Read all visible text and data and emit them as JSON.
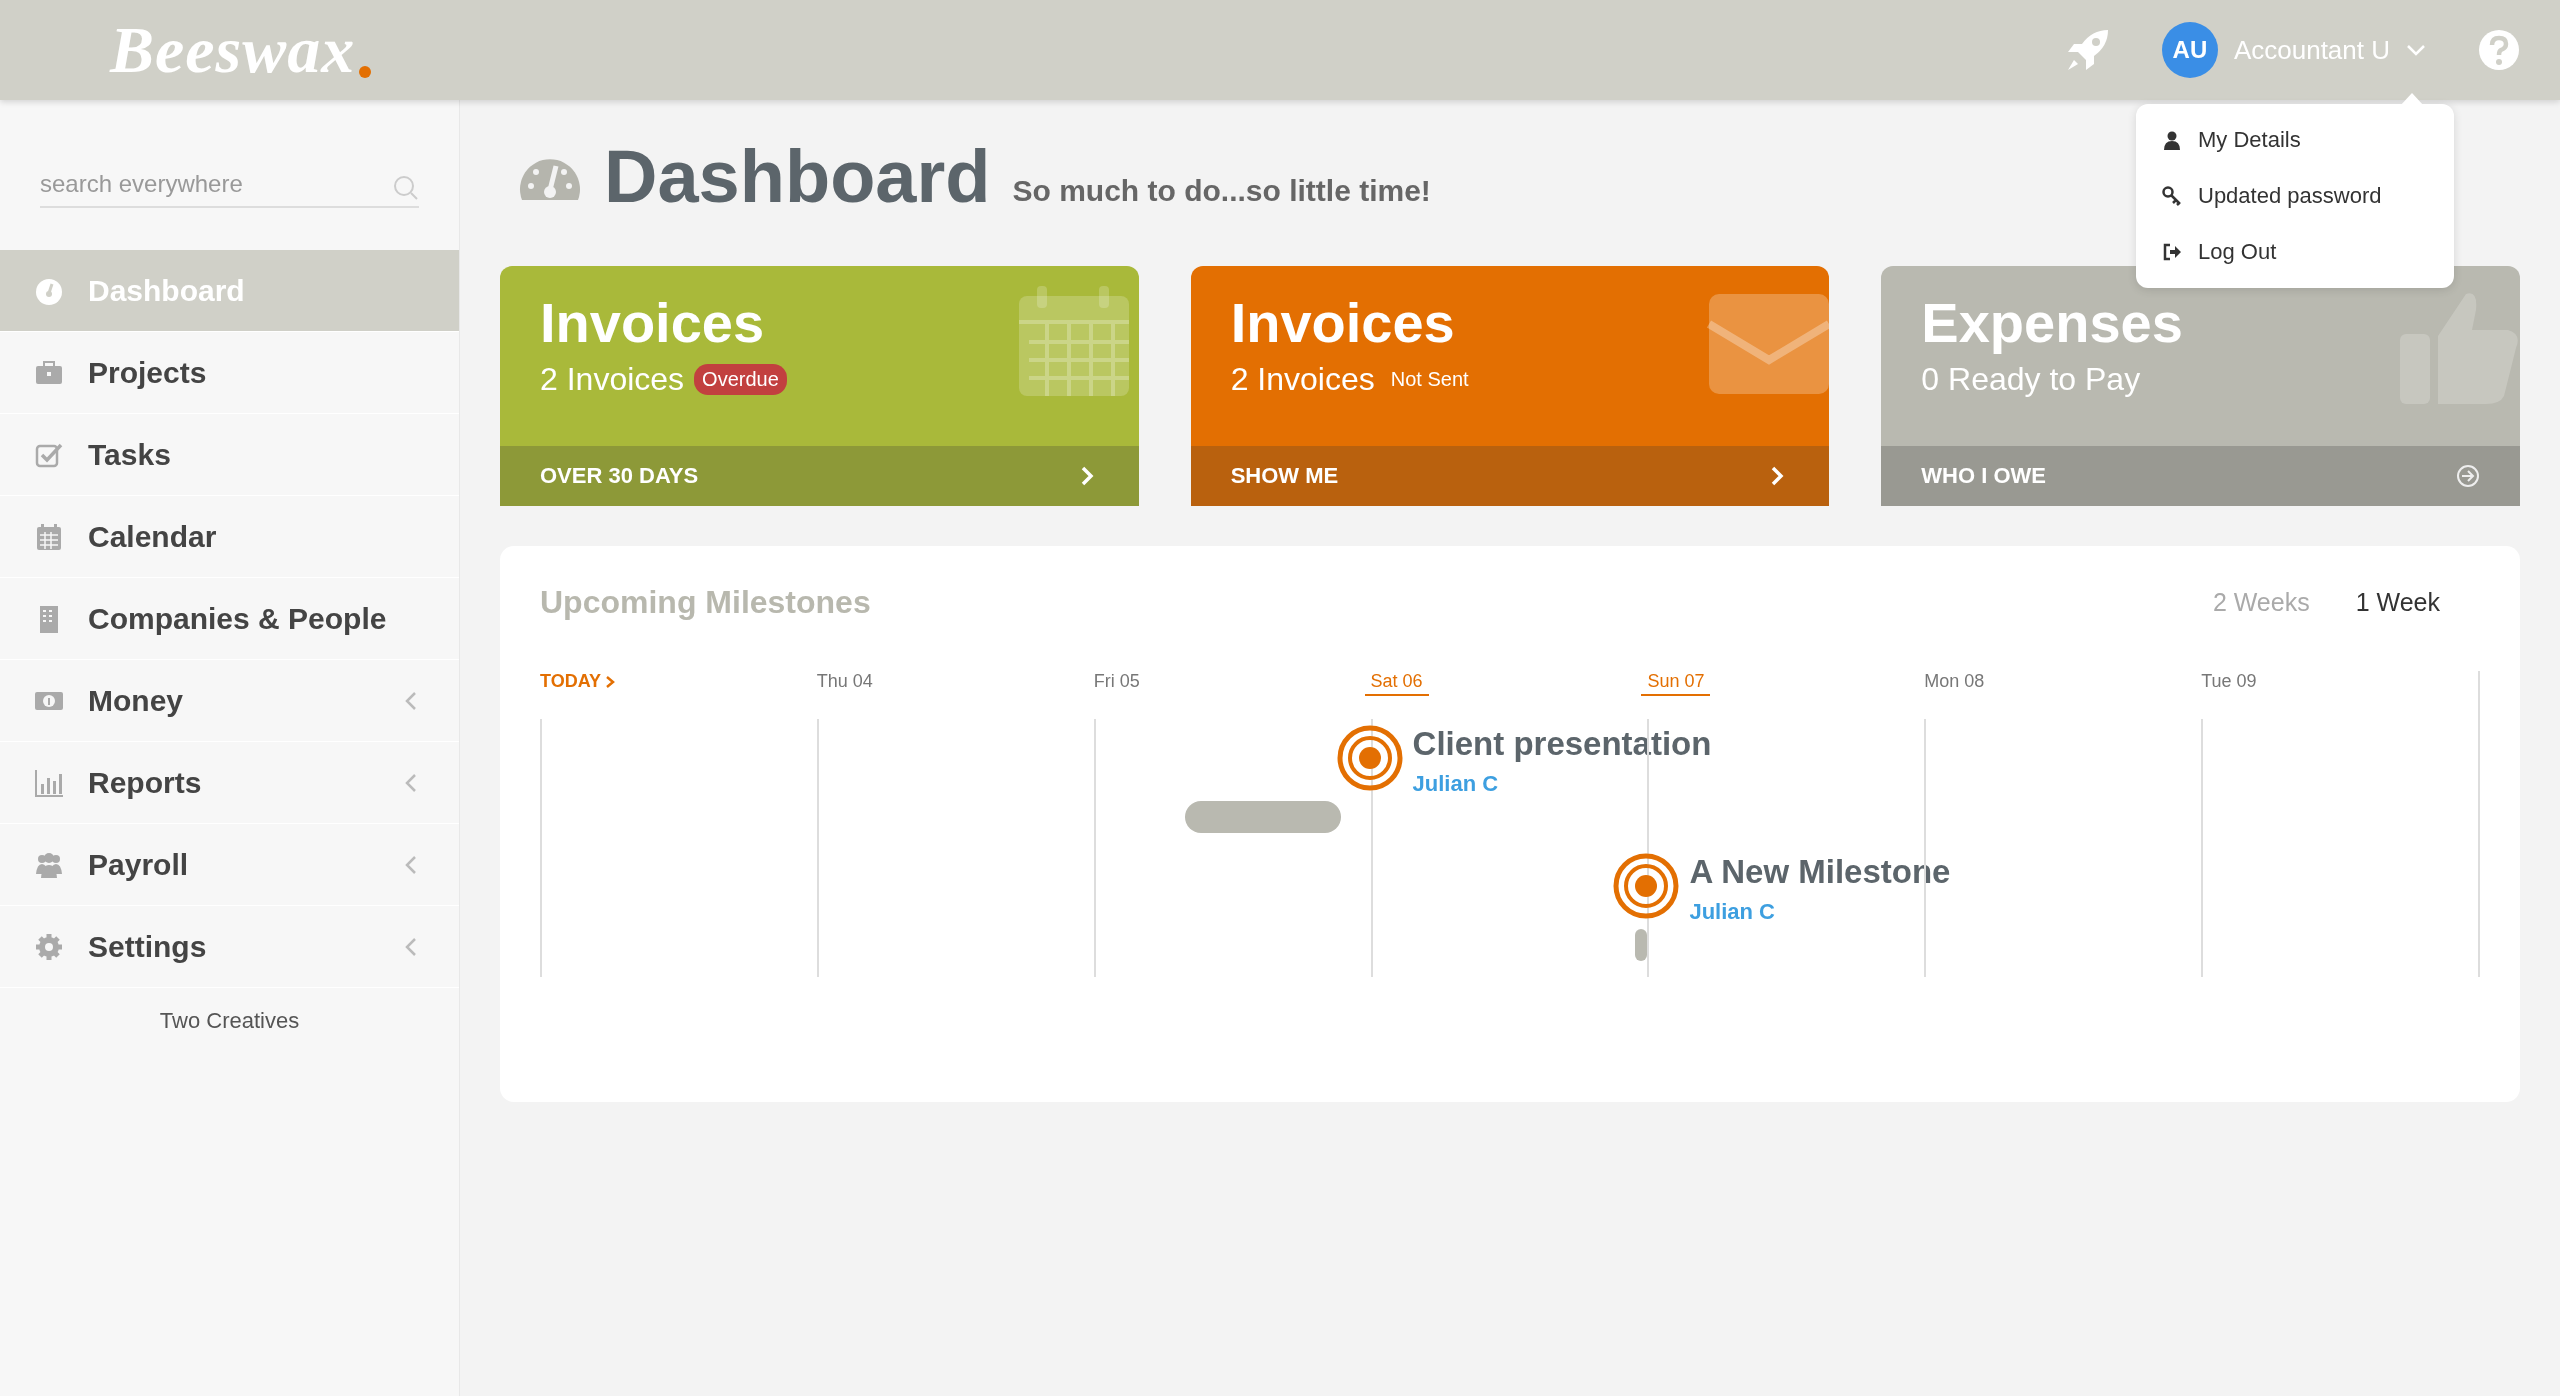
{
  "topbar": {
    "logo": "Beeswax",
    "user": {
      "initials": "AU",
      "name": "Accountant U"
    }
  },
  "user_menu": {
    "expanded": true,
    "items": [
      "My Details",
      "Updated password",
      "Log Out"
    ]
  },
  "sidebar": {
    "search": {
      "placeholder": "search everywhere"
    },
    "items": [
      {
        "label": "Dashboard",
        "selected": true,
        "expandable": false
      },
      {
        "label": "Projects",
        "selected": false,
        "expandable": false
      },
      {
        "label": "Tasks",
        "selected": false,
        "expandable": false
      },
      {
        "label": "Calendar",
        "selected": false,
        "expandable": false
      },
      {
        "label": "Companies & People",
        "selected": false,
        "expandable": false
      },
      {
        "label": "Money",
        "selected": false,
        "expandable": true
      },
      {
        "label": "Reports",
        "selected": false,
        "expandable": true
      },
      {
        "label": "Payroll",
        "selected": false,
        "expandable": true
      },
      {
        "label": "Settings",
        "selected": false,
        "expandable": true
      }
    ],
    "footer": "Two Creatives"
  },
  "page": {
    "title": "Dashboard",
    "subtitle": "So much to do...so little time!"
  },
  "cards": [
    {
      "title": "Invoices",
      "count": "2 Invoices",
      "badge": {
        "text": "Overdue",
        "kind": "pill"
      },
      "action": {
        "label": "OVER 30 DAYS",
        "kind": "chevron"
      },
      "color": "#a9b93a"
    },
    {
      "title": "Invoices",
      "count": "2 Invoices",
      "badge": {
        "text": "Not Sent",
        "kind": "plain"
      },
      "action": {
        "label": "SHOW ME",
        "kind": "chevron"
      },
      "color": "#e36f02"
    },
    {
      "title": "Expenses",
      "count": "0 Ready to Pay",
      "action": {
        "label": "WHO I OWE",
        "kind": "circle-arrow"
      },
      "color": "#b9b9b0"
    }
  ],
  "milestones": {
    "title": "Upcoming Milestones",
    "tabs": [
      {
        "label": "2 Weeks",
        "selected": false
      },
      {
        "label": "1 Week",
        "selected": true
      }
    ],
    "days": [
      {
        "label": "TODAY",
        "kind": "today"
      },
      {
        "label": "Thu 04",
        "kind": "day",
        "highlighted": false
      },
      {
        "label": "Fri 05",
        "kind": "day",
        "highlighted": false
      },
      {
        "label": "Sat 06",
        "kind": "day",
        "highlighted": true,
        "milestones": [
          {
            "title": "Client presentation",
            "owner": "Julian C",
            "kind": "span"
          }
        ]
      },
      {
        "label": "Sun 07",
        "kind": "day",
        "highlighted": true,
        "milestones": [
          {
            "title": "A New Milestone",
            "owner": "Julian C",
            "kind": "point"
          }
        ]
      },
      {
        "label": "Mon 08",
        "kind": "day",
        "highlighted": false
      },
      {
        "label": "Tue 09",
        "kind": "day",
        "highlighted": false
      }
    ]
  }
}
